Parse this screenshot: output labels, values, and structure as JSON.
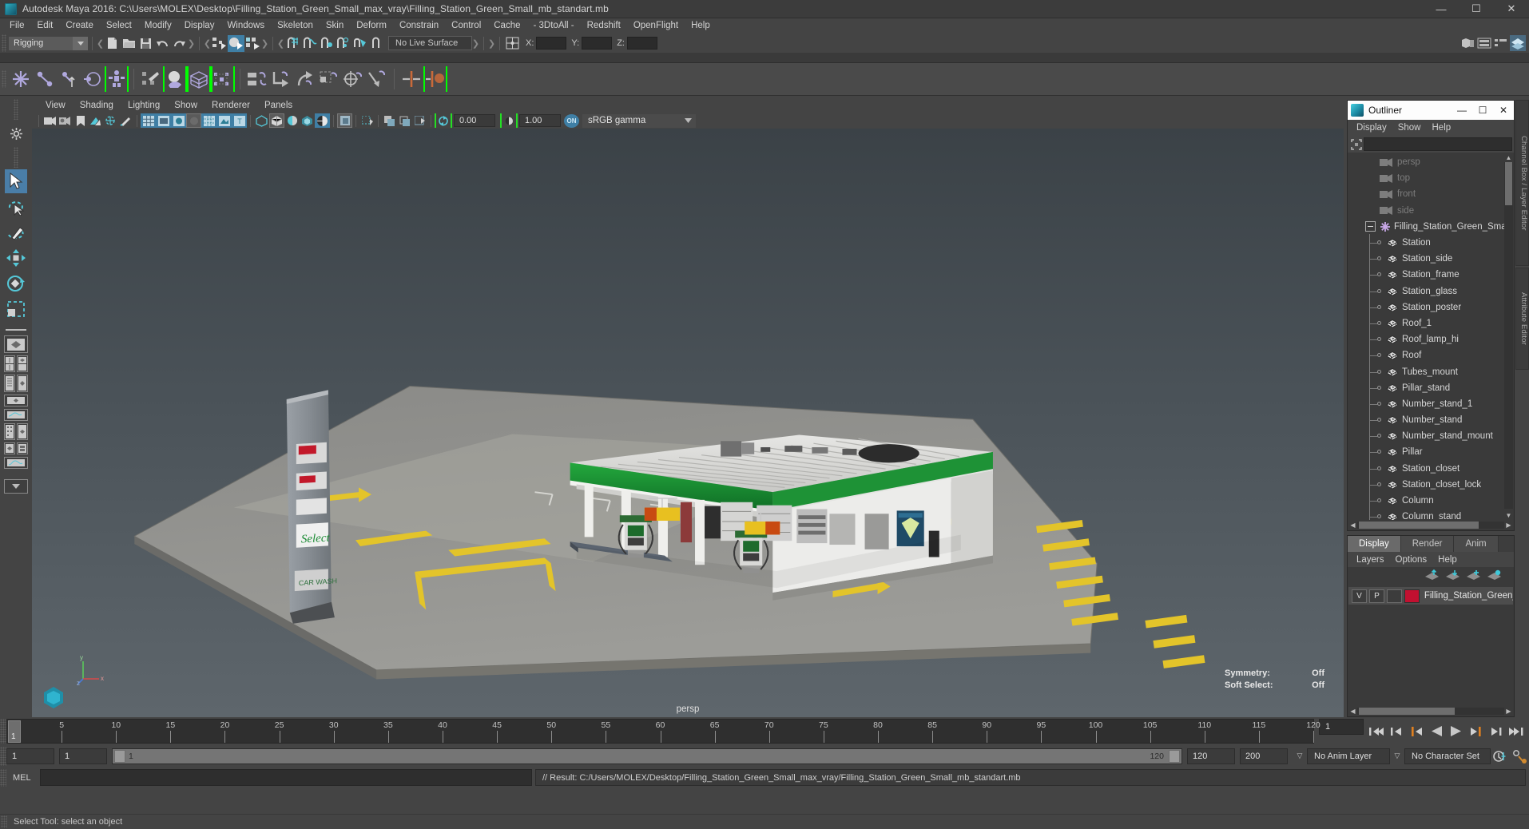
{
  "window": {
    "title": "Autodesk Maya 2016: C:\\Users\\MOLEX\\Desktop\\Filling_Station_Green_Small_max_vray\\Filling_Station_Green_Small_mb_standart.mb",
    "app_icon": "maya-logo-icon",
    "minimize": "—",
    "maximize": "☐",
    "close": "✕"
  },
  "menubar": {
    "items": [
      "File",
      "Edit",
      "Create",
      "Select",
      "Modify",
      "Display",
      "Windows",
      "Skeleton",
      "Skin",
      "Deform",
      "Constrain",
      "Control",
      "Cache",
      "- 3DtoAll -",
      "Redshift",
      "OpenFlight",
      "Help"
    ]
  },
  "statusbar": {
    "mode": "Rigging",
    "mode_arrow": "▼",
    "live_surface": "No Live Surface",
    "coord_x_label": "X:",
    "coord_y_label": "Y:",
    "coord_z_label": "Z:",
    "coord_x": "",
    "coord_y": "",
    "coord_z": ""
  },
  "viewport": {
    "menu": [
      "View",
      "Shading",
      "Lighting",
      "Show",
      "Renderer",
      "Panels"
    ],
    "exposure_value": "0.00",
    "gamma_value": "1.00",
    "on_badge": "ON",
    "color_profile": "sRGB gamma",
    "color_profile_arrow": "▼",
    "camera_label": "persp",
    "symmetry_label": "Symmetry:",
    "symmetry_value": "Off",
    "soft_select_label": "Soft Select:",
    "soft_select_value": "Off",
    "axis_x": "x",
    "axis_y": "y",
    "axis_z": "z",
    "scene_description": "Green filling station 3D model with canopy, two fuel pumps, price totem sign and asphalt lot"
  },
  "outliner": {
    "title": "Outliner",
    "minimize": "—",
    "maximize": "☐",
    "close": "✕",
    "menu": [
      "Display",
      "Show",
      "Help"
    ],
    "search_value": "",
    "scroll_up": "▲",
    "scroll_down": "▼",
    "scroll_left": "◀",
    "scroll_right": "▶",
    "items": [
      {
        "label": "persp",
        "type": "camera",
        "indent": 1
      },
      {
        "label": "top",
        "type": "camera",
        "indent": 1
      },
      {
        "label": "front",
        "type": "camera",
        "indent": 1
      },
      {
        "label": "side",
        "type": "camera",
        "indent": 1
      },
      {
        "label": "Filling_Station_Green_Sma",
        "type": "group",
        "indent": 0
      },
      {
        "label": "Station",
        "type": "mesh",
        "indent": 1
      },
      {
        "label": "Station_side",
        "type": "mesh",
        "indent": 1
      },
      {
        "label": "Station_frame",
        "type": "mesh",
        "indent": 1
      },
      {
        "label": "Station_glass",
        "type": "mesh",
        "indent": 1
      },
      {
        "label": "Station_poster",
        "type": "mesh",
        "indent": 1
      },
      {
        "label": "Roof_1",
        "type": "mesh",
        "indent": 1
      },
      {
        "label": "Roof_lamp_hi",
        "type": "mesh",
        "indent": 1
      },
      {
        "label": "Roof",
        "type": "mesh",
        "indent": 1
      },
      {
        "label": "Tubes_mount",
        "type": "mesh",
        "indent": 1
      },
      {
        "label": "Pillar_stand",
        "type": "mesh",
        "indent": 1
      },
      {
        "label": "Number_stand_1",
        "type": "mesh",
        "indent": 1
      },
      {
        "label": "Number_stand",
        "type": "mesh",
        "indent": 1
      },
      {
        "label": "Number_stand_mount",
        "type": "mesh",
        "indent": 1
      },
      {
        "label": "Pillar",
        "type": "mesh",
        "indent": 1
      },
      {
        "label": "Station_closet",
        "type": "mesh",
        "indent": 1
      },
      {
        "label": "Station_closet_lock",
        "type": "mesh",
        "indent": 1
      },
      {
        "label": "Column",
        "type": "mesh",
        "indent": 1
      },
      {
        "label": "Column_stand",
        "type": "mesh",
        "indent": 1
      }
    ]
  },
  "side_tabs": [
    "Channel Box / Layer Editor",
    "Attribute Editor"
  ],
  "layer_editor": {
    "tabs": [
      "Display",
      "Render",
      "Anim"
    ],
    "active_tab": "Display",
    "menu": [
      "Layers",
      "Options",
      "Help"
    ],
    "rows": [
      {
        "visible": "V",
        "playback": "P",
        "shade": "",
        "color": "#c21030",
        "name": "Filling_Station_Green_S"
      }
    ]
  },
  "timeline": {
    "ticks": [
      5,
      10,
      15,
      20,
      25,
      30,
      35,
      40,
      45,
      50,
      55,
      60,
      65,
      70,
      75,
      80,
      85,
      90,
      95,
      100,
      105,
      110,
      115,
      120
    ],
    "start": 1,
    "end": 120,
    "current_frame": "1",
    "current_frame_field": "1",
    "range_start": "1",
    "range_start_2": "1",
    "range_inner_start": "1",
    "range_inner_end": "120",
    "range_end": "120",
    "playback_end": "200",
    "anim_layer": "No Anim Layer",
    "character_set": "No Character Set",
    "playback_arrow": "▽"
  },
  "command_line": {
    "label": "MEL",
    "input_value": "",
    "output": "// Result: C:/Users/MOLEX/Desktop/Filling_Station_Green_Small_max_vray/Filling_Station_Green_Small_mb_standart.mb"
  },
  "help_line": {
    "text": "Select Tool: select an object"
  },
  "colors": {
    "accent_blue": "#3f7fa5",
    "shelf_green": "#24e024",
    "layer_red": "#c21030",
    "station_green": "#1b9633",
    "road_yellow": "#e8c020"
  }
}
